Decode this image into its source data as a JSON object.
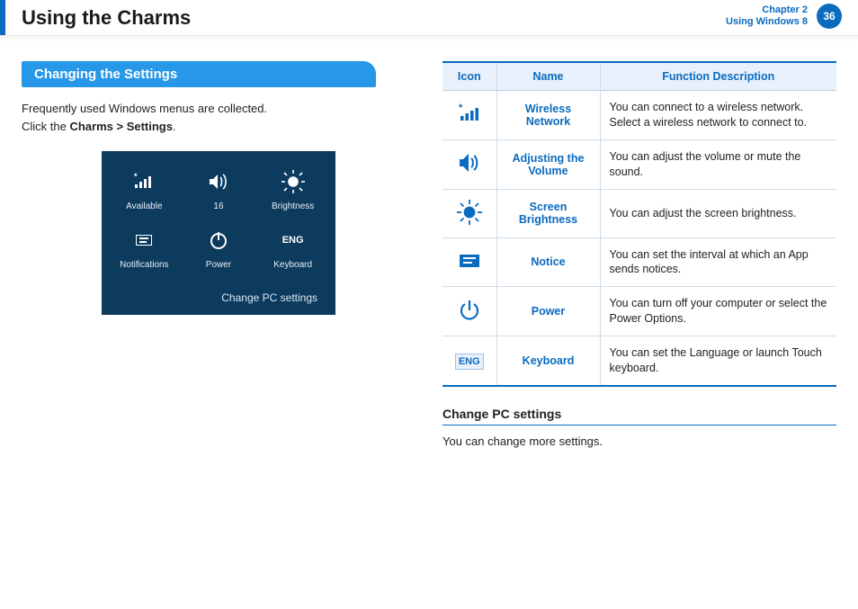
{
  "header": {
    "title": "Using the Charms",
    "chapter_line1": "Chapter 2",
    "chapter_line2": "Using Windows 8",
    "page_no": "36"
  },
  "section": {
    "heading": "Changing the Settings"
  },
  "intro": {
    "line1": "Frequently used Windows menus are collected.",
    "line2_pre": "Click the ",
    "line2_bold": "Charms > Settings",
    "line2_post": "."
  },
  "panel": {
    "r1": {
      "a": "Available",
      "b": "16",
      "c": "Brightness"
    },
    "r2": {
      "a": "Notifications",
      "b": "Power",
      "c": "Keyboard",
      "c_icon_text": "ENG"
    },
    "footer": "Change PC settings"
  },
  "table": {
    "h1": "Icon",
    "h2": "Name",
    "h3": "Function Description",
    "rows": [
      {
        "name": "Wireless Network",
        "desc": "You can connect to a wireless network. Select a wireless network to connect to."
      },
      {
        "name": "Adjusting the Volume",
        "desc": "You can adjust the volume or mute the sound."
      },
      {
        "name": "Screen Brightness",
        "desc": "You can adjust the screen brightness."
      },
      {
        "name": "Notice",
        "desc": "You can set the interval at which an App sends notices."
      },
      {
        "name": "Power",
        "desc": "You can turn off your computer or select the Power Options."
      },
      {
        "name": "Keyboard",
        "desc": "You can set the Language or launch Touch keyboard.",
        "icon_text": "ENG"
      }
    ]
  },
  "sub": {
    "heading": "Change PC settings",
    "body": "You can change more settings."
  }
}
